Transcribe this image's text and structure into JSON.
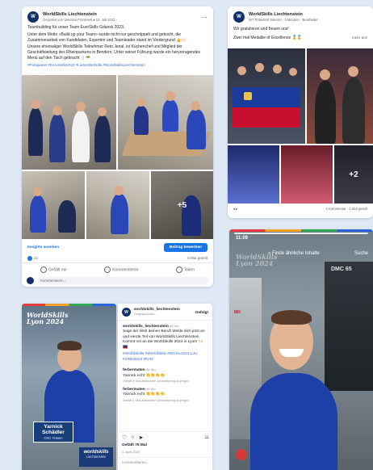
{
  "post1": {
    "author": "WorldSkills Liechtenstein",
    "meta": "Gepostet von Vanessa Frommelt ● 15. Juli 2023 ·",
    "line1": "Teambuilding für unser Team EuroSkills Gdansk 2023.",
    "body": "Unter dem Motto «Build up your Team» wurde nicht nur geschnippelt und gekocht, die Zusammenarbeit von Kandidaten, Experten und Teamleader stand im Vordergrund 👍🙌🏻",
    "body2": "Unsere ehemaliger WorldSkills Teilnehmer Reto Jenal, ist Küchenchef und Mitglied der Geschäftsleitung des Rheinparkens in Bendern. Unter seiner Führung wurde ein hervorragendes Menü auf den Tisch gebracht 🍴🥗",
    "tags": "#Potsjaanel #EuroSkills2023 #LiebesBeSkills #WorldSkillsLiechtenstein",
    "more_count": "+5",
    "insights": "Insights ansehen",
    "boost": "Beitrag bewerben",
    "reactions": "22",
    "views": "5 Mal geteilt",
    "like": "Gefällt mir",
    "comment": "Kommentieren",
    "share": "Teilen",
    "comment_placeholder": "Kommentieren..."
  },
  "post2": {
    "author": "WorldSkills Liechtenstein",
    "meta": "WT Präsident Internet · 3 Minuten · Bearbeitet ·",
    "line1": "Wir gratulieren und freuen uns!",
    "line2": "Zwei mal Medallie of Excellence 🏅🏅",
    "more": "mehr anz",
    "more_count": "+2",
    "footer": "1 Kommentar · 1 Mal geteilt"
  },
  "story1": {
    "title": "WorldSkills Lyon 2024",
    "name1": "Yarnick",
    "name2": "Schädler",
    "role": "CNC Fräsen",
    "brand": "worldskills",
    "brand2": "Liechtenstein"
  },
  "ig": {
    "account": "worldskills_liechtenstein",
    "follow": "Gefolgt",
    "audio": "Original-Audio",
    "caption_user": "worldskills_liechtenstein",
    "caption_time": "46 Wo.",
    "caption": "Sage der Welt deinen Beruf! Melde dich jetzt an und werde Teil von WorldSkills Liechtenstein. Kommt mit an die WorldSkills 2024 in Lyon! 🙌🏻🇱🇮",
    "caption_tags": "#WorldSkills #WorldSkills #WCHL2024 LJU FOND2024 #FAR",
    "c1_user": "ferbermaten",
    "c1_time": "46 Wo.",
    "c1_text": "Yannick echt 👏👏👏👏",
    "c1_meta": "Gefällt 1 Mal  Antworten  Übersetzung anzeigen",
    "c2_user": "ferbermaten",
    "c2_time": "46 Wo.",
    "c2_text": "Yannick echt 👏👏👏👏",
    "c2_meta": "Gefällt 1 Mal  Antworten  Übersetzung anzeigen",
    "likes": "Gefällt 75 Mal",
    "date": "4. April 2023",
    "comment_placeholder": "Kommentieren..."
  },
  "story2": {
    "time": "11:09",
    "search_hint": "Finde ähnliche Inhalte",
    "search": "Suche",
    "overlay_title": "WorldSkills Lyon 2024",
    "machine_label": "DMC 65",
    "side_label": "MH"
  }
}
